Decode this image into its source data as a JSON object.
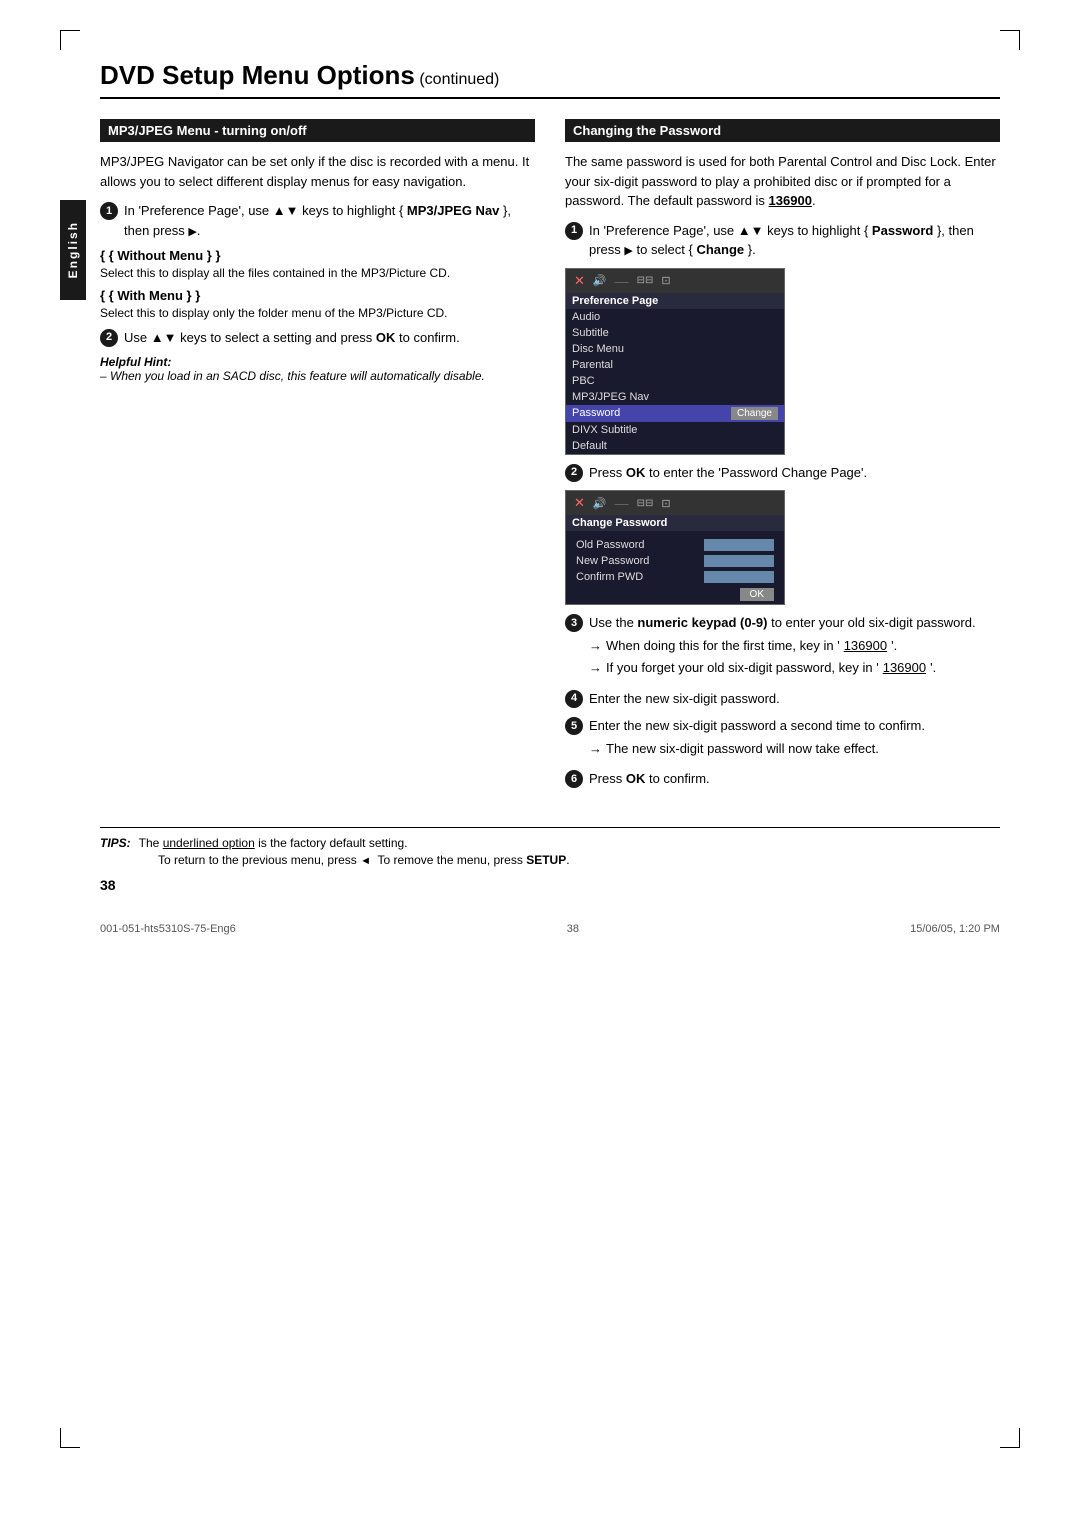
{
  "page": {
    "title": "DVD Setup Menu Options",
    "title_suffix": " continued",
    "english_label": "English",
    "page_number": "38",
    "footer_left": "001-051-hts5310S-75-Eng6",
    "footer_center": "38",
    "footer_right": "15/06/05, 1:20 PM"
  },
  "left_section": {
    "header": "MP3/JPEG Menu - turning on/off",
    "intro": "MP3/JPEG Navigator can be set only if the disc is recorded with a menu. It allows you to select different display menus for easy navigation.",
    "step1": {
      "text1": "In 'Preference Page', use",
      "triangle": "▲▼",
      "text2": "keys to highlight {",
      "bold": "MP3/JPEG Nav",
      "text3": "}, then press",
      "arrow": "▶",
      "text4": "."
    },
    "without_menu": {
      "label": "{ Without Menu }",
      "desc": "Select this to display all the files contained in the MP3/Picture CD."
    },
    "with_menu": {
      "label": "{ With Menu }",
      "desc": "Select this to display only the folder menu of the MP3/Picture CD."
    },
    "step2": {
      "text1": "Use",
      "triangle": "▲▼",
      "text2": "keys to select a setting and press",
      "bold": "OK",
      "text3": "to confirm."
    },
    "helpful_hint": {
      "label": "Helpful Hint:",
      "text": "– When you load in an SACD disc, this feature will automatically disable."
    }
  },
  "right_section": {
    "header": "Changing the Password",
    "intro": "The same password is used for both Parental Control and Disc Lock. Enter your six-digit password to play a prohibited disc or if prompted for a password. The default password is",
    "default_password": "136900",
    "step1": {
      "text1": "In 'Preference Page', use",
      "triangle": "▲▼",
      "text2": "keys to highlight {",
      "bold": "Password",
      "text3": "}, then press",
      "arrow": "▶",
      "text4": "to select {",
      "bold2": "Change",
      "text5": "}."
    },
    "pref_page": {
      "title": "Preference Page",
      "items": [
        "Audio",
        "Subtitle",
        "Disc Menu",
        "Parental",
        "PBC",
        "MP3/JPEG Nav"
      ],
      "highlighted": "Password",
      "highlighted_btn": "Change",
      "items_after": [
        "DIVX Subtitle",
        "Default"
      ]
    },
    "step2_text": "Press",
    "step2_bold": "OK",
    "step2_rest": "to enter the 'Password Change Page'.",
    "pwd_page": {
      "title": "Change Password",
      "old_label": "Old Password",
      "new_label": "New Password",
      "confirm_label": "Confirm PWD",
      "ok_btn": "OK"
    },
    "step3": {
      "text1": "Use the",
      "bold": "numeric keypad (0-9)",
      "text2": "to enter your old six-digit password.",
      "arrow1": "When doing this for the first time, key in '",
      "password1": "136900",
      "arrow1_end": "'.",
      "arrow2": "If you forget your old six-digit password, key in '",
      "password2": "136900",
      "arrow2_end": "'."
    },
    "step4": "Enter the new six-digit password.",
    "step5": {
      "text": "Enter the new six-digit password a second time to confirm.",
      "arrow": "The new six-digit password will now take effect."
    },
    "step6_text": "Press",
    "step6_bold": "OK",
    "step6_rest": "to confirm."
  },
  "tips": {
    "label": "TIPS:",
    "tip1": "The underlined option is the factory default setting.",
    "tip2": "To return to the previous menu, press",
    "tip2_arrow": "◄",
    "tip2_rest": "To remove the menu, press",
    "tip2_bold": "SETUP",
    "tip2_end": "."
  }
}
